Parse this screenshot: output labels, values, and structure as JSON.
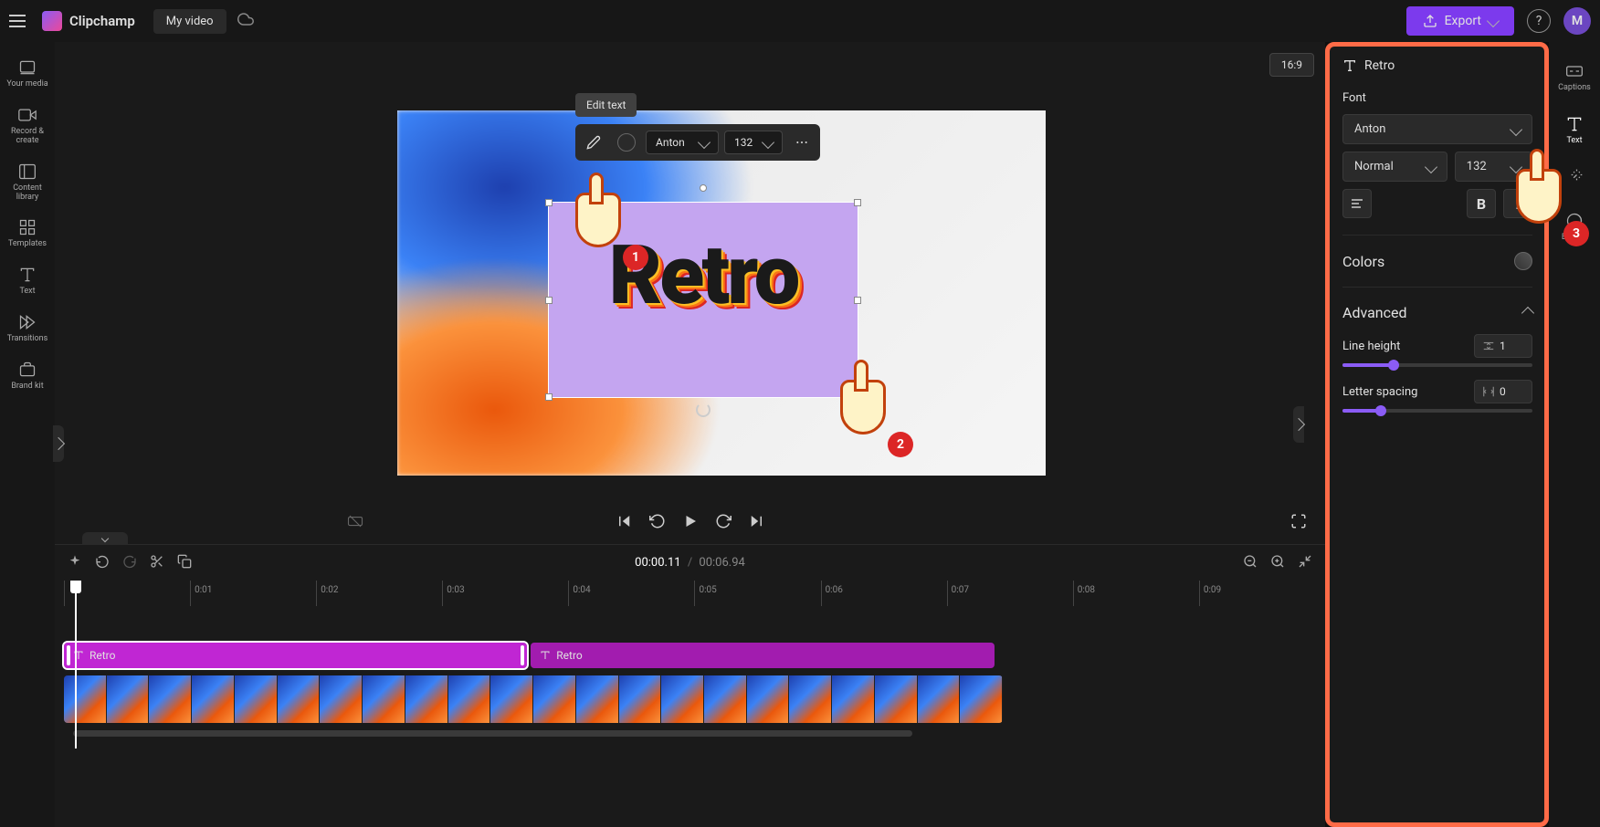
{
  "brand": "Clipchamp",
  "project_name": "My video",
  "top": {
    "export_label": "Export",
    "avatar_initial": "M"
  },
  "left_sidebar": {
    "items": [
      {
        "label": "Your media",
        "icon": "media-icon"
      },
      {
        "label": "Record & create",
        "icon": "camera-icon"
      },
      {
        "label": "Content library",
        "icon": "library-icon"
      },
      {
        "label": "Templates",
        "icon": "templates-icon"
      },
      {
        "label": "Text",
        "icon": "text-icon"
      },
      {
        "label": "Transitions",
        "icon": "transitions-icon"
      },
      {
        "label": "Brand kit",
        "icon": "brandkit-icon"
      }
    ]
  },
  "right_sidebar": {
    "items": [
      {
        "label": "Captions",
        "icon": "captions-icon"
      },
      {
        "label": "Text",
        "icon": "text-icon"
      },
      {
        "label": "",
        "icon": "wand-icon"
      },
      {
        "label": "Effects",
        "icon": "effects-icon"
      }
    ]
  },
  "preview": {
    "aspect_label": "16:9",
    "edit_tooltip": "Edit text",
    "toolbar": {
      "font": "Anton",
      "size": "132"
    },
    "text_content": "Retro"
  },
  "pointers": {
    "one": "1",
    "two": "2",
    "three": "3"
  },
  "timeline_toolbar": {
    "current_time": "00:00.11",
    "separator": "/",
    "total_time": "00:06.94"
  },
  "ruler": {
    "ticks": [
      "0:01",
      "0:02",
      "0:03",
      "0:04",
      "0:05",
      "0:06",
      "0:07",
      "0:08",
      "0:09"
    ]
  },
  "clips": {
    "clip1_label": "Retro",
    "clip2_label": "Retro"
  },
  "props": {
    "title": "Retro",
    "font_label": "Font",
    "font_value": "Anton",
    "weight_value": "Normal",
    "size_value": "132",
    "bold": "B",
    "italic": "I",
    "colors_label": "Colors",
    "advanced_label": "Advanced",
    "line_height_label": "Line height",
    "line_height_value": "1",
    "line_height_pct": 27,
    "letter_spacing_label": "Letter spacing",
    "letter_spacing_value": "0",
    "letter_spacing_pct": 20
  }
}
